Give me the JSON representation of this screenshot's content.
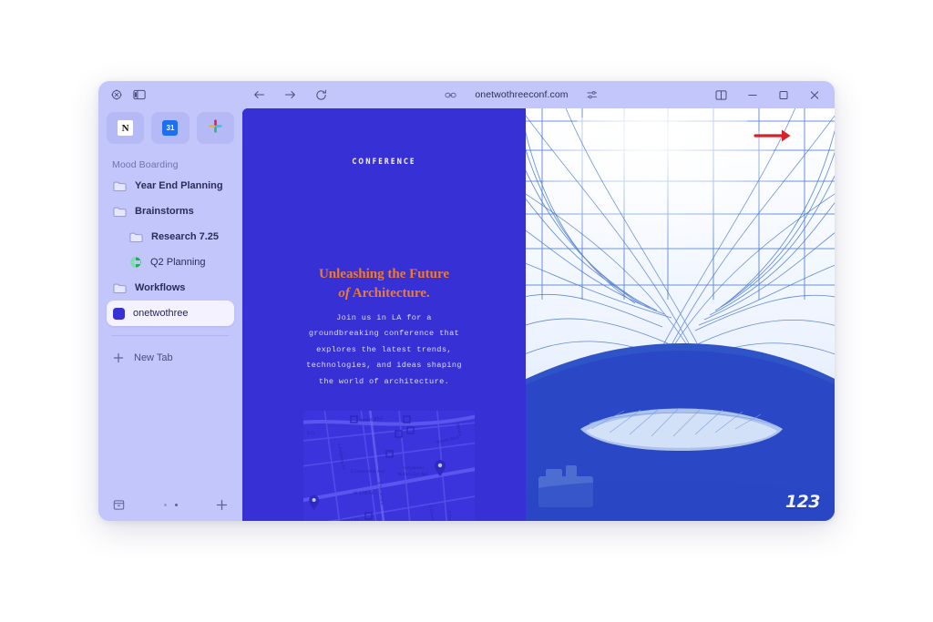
{
  "window": {
    "toolbar": {
      "compass_icon": "compass-icon",
      "sidebar_toggle_icon": "sidebar-toggle-icon",
      "back_icon": "back-arrow-icon",
      "forward_icon": "forward-arrow-icon",
      "reload_icon": "reload-icon",
      "link_icon": "link-icon",
      "url": "onetwothreeconf.com",
      "settings_icon": "page-settings-icon",
      "split_view_icon": "split-view-icon",
      "minimize_icon": "minimize-icon",
      "maximize_icon": "maximize-icon",
      "close_icon": "close-icon"
    }
  },
  "sidebar": {
    "apps": [
      {
        "name": "notion-app-shortcut",
        "label": "N"
      },
      {
        "name": "calendar-app-shortcut",
        "label": "31"
      },
      {
        "name": "slack-app-shortcut",
        "label": ""
      }
    ],
    "section_label": "Mood Boarding",
    "items": [
      {
        "label": "Year End Planning",
        "icon": "folder-icon",
        "style": "bold",
        "indent": false,
        "active": false
      },
      {
        "label": "Brainstorms",
        "icon": "folder-icon",
        "style": "bold",
        "indent": false,
        "active": false
      },
      {
        "label": "Research 7.25",
        "icon": "folder-icon",
        "style": "bold",
        "indent": true,
        "active": false
      },
      {
        "label": "Q2 Planning",
        "icon": "circle-c-icon",
        "style": "normal",
        "indent": true,
        "active": false
      },
      {
        "label": "Workflows",
        "icon": "folder-icon",
        "style": "bold",
        "indent": false,
        "active": false
      },
      {
        "label": "onetwothree",
        "icon": "square-favicon",
        "style": "normal",
        "indent": false,
        "active": true
      }
    ],
    "new_tab_label": "New Tab",
    "new_tab_icon": "plus-icon",
    "archive_icon": "archive-icon",
    "add_icon": "plus-icon"
  },
  "page": {
    "eyebrow": "CONFERENCE",
    "headline_line1": "Unleashing the Future",
    "headline_line2_em": "of",
    "headline_line2": "Architecture.",
    "body_lines": [
      "Join us in LA for a",
      "groundbreaking conference that",
      "explores the latest trends,",
      "technologies, and ideas shaping",
      "the world of architecture."
    ],
    "map": {
      "labels": [
        "Venice Blvd",
        "Venice Blvd",
        "S Cloverdale Ave",
        "S Ridgeley Dr",
        "W Olympic Blvd",
        "W 17th St",
        "Hollywood Notary Dot Net",
        "Saturn St",
        "S Curson Ave"
      ],
      "pin_icon": "map-pin-icon"
    },
    "photo": {
      "name": "architecture-gridshell-photo",
      "arrow_icon": "red-arrow-right-icon",
      "logo": "123"
    }
  },
  "colors": {
    "sidebar_bg": "#c3c6fa",
    "page_blue": "#3730d4",
    "accent_orange": "#ee7a2e",
    "arrow_red": "#d6232a",
    "active_tab_bg": "#f3f2fe"
  }
}
